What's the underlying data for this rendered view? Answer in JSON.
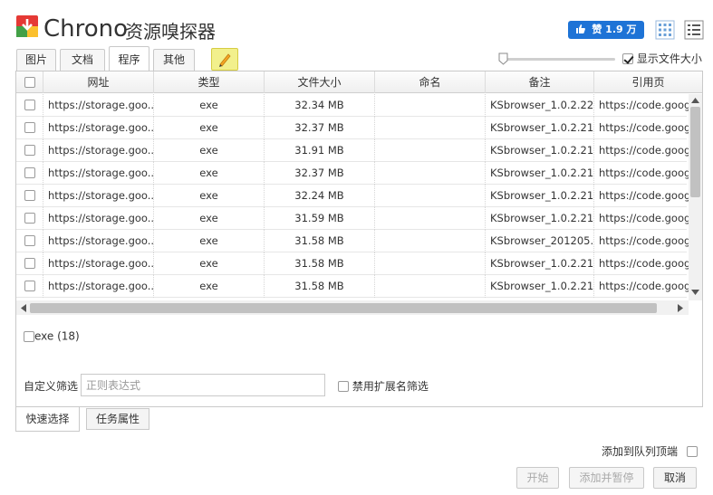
{
  "header": {
    "title": "Chrono",
    "subtitle": "资源嗅探器",
    "like_label": "赞 1.9 万"
  },
  "tabs": [
    {
      "label": "图片",
      "active": false
    },
    {
      "label": "文档",
      "active": false
    },
    {
      "label": "程序",
      "active": true
    },
    {
      "label": "其他",
      "active": false
    }
  ],
  "options": {
    "show_file_size_label": "显示文件大小",
    "show_file_size_checked": true
  },
  "table": {
    "columns": [
      "网址",
      "类型",
      "文件大小",
      "命名",
      "备注",
      "引用页"
    ],
    "rows": [
      {
        "url": "https://storage.goo...",
        "type": "exe",
        "size": "32.34 MB",
        "name": "",
        "note": "KSbrowser_1.0.2.22...",
        "ref": "https://code.googl"
      },
      {
        "url": "https://storage.goo...",
        "type": "exe",
        "size": "32.37 MB",
        "name": "",
        "note": "KSbrowser_1.0.2.21...",
        "ref": "https://code.googl"
      },
      {
        "url": "https://storage.goo...",
        "type": "exe",
        "size": "31.91 MB",
        "name": "",
        "note": "KSbrowser_1.0.2.21...",
        "ref": "https://code.googl"
      },
      {
        "url": "https://storage.goo...",
        "type": "exe",
        "size": "32.37 MB",
        "name": "",
        "note": "KSbrowser_1.0.2.21...",
        "ref": "https://code.googl"
      },
      {
        "url": "https://storage.goo...",
        "type": "exe",
        "size": "32.24 MB",
        "name": "",
        "note": "KSbrowser_1.0.2.21...",
        "ref": "https://code.googl"
      },
      {
        "url": "https://storage.goo...",
        "type": "exe",
        "size": "31.59 MB",
        "name": "",
        "note": "KSbrowser_1.0.2.21...",
        "ref": "https://code.googl"
      },
      {
        "url": "https://storage.goo...",
        "type": "exe",
        "size": "31.58 MB",
        "name": "",
        "note": "KSbrowser_201205...",
        "ref": "https://code.googl"
      },
      {
        "url": "https://storage.goo...",
        "type": "exe",
        "size": "31.58 MB",
        "name": "",
        "note": "KSbrowser_1.0.2.21...",
        "ref": "https://code.googl"
      },
      {
        "url": "https://storage.goo...",
        "type": "exe",
        "size": "31.58 MB",
        "name": "",
        "note": "KSbrowser_1.0.2.21...",
        "ref": "https://code.googl"
      }
    ]
  },
  "filters": {
    "exe_label": "exe (18)",
    "custom_filter_label": "自定义筛选",
    "regex_placeholder": "正则表达式",
    "disable_ext_label": "禁用扩展名筛选"
  },
  "bottom_tabs": [
    {
      "label": "快速选择",
      "active": true
    },
    {
      "label": "任务属性",
      "active": false
    }
  ],
  "footer": {
    "queue_top_label": "添加到队列顶端",
    "start_label": "开始",
    "add_pause_label": "添加并暂停",
    "cancel_label": "取消"
  },
  "colors": {
    "like_button": "#1e73d6",
    "pencil_tab": "#f2f08c"
  }
}
